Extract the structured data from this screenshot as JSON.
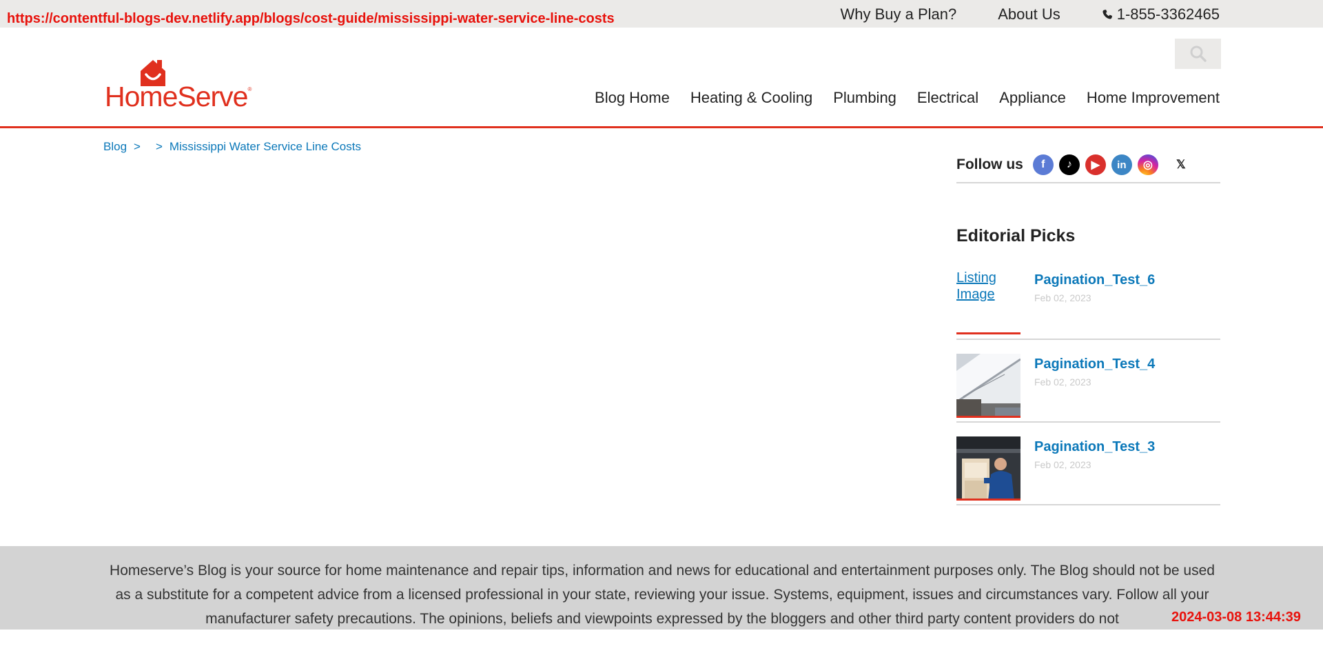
{
  "overlay": {
    "url": "https://contentful-blogs-dev.netlify.app/blogs/cost-guide/mississippi-water-service-line-costs",
    "timestamp": "2024-03-08 13:44:39"
  },
  "utility_nav": {
    "links": [
      "Why Buy a Plan?",
      "About Us"
    ],
    "phone": "1-855-3362465"
  },
  "brand": {
    "logo_text": "HomeServe",
    "logo_mark": "®",
    "color": "#e0301e"
  },
  "main_nav": {
    "items": [
      "Blog Home",
      "Heating & Cooling",
      "Plumbing",
      "Electrical",
      "Appliance",
      "Home Improvement"
    ]
  },
  "breadcrumb": {
    "items": [
      "Blog",
      "Mississippi Water Service Line Costs"
    ],
    "separator": ">"
  },
  "sidebar": {
    "follow_label": "Follow us",
    "social": [
      "facebook-icon",
      "tiktok-icon",
      "youtube-icon",
      "linkedin-icon",
      "instagram-icon",
      "x-icon"
    ],
    "editorial_title": "Editorial Picks",
    "picks": [
      {
        "title": "Pagination_Test_6",
        "date": "Feb 02, 2023",
        "image_alt": "Listing Image"
      },
      {
        "title": "Pagination_Test_4",
        "date": "Feb 02, 2023"
      },
      {
        "title": "Pagination_Test_3",
        "date": "Feb 02, 2023"
      }
    ]
  },
  "footer": {
    "disclaimer": "Homeserve’s Blog is your source for home maintenance and repair tips, information and news for educational and entertainment purposes only. The Blog should not be used as a substitute for a competent advice from a licensed professional in your state, reviewing your issue. Systems, equipment, issues and circumstances vary. Follow all your manufacturer safety precautions. The opinions, beliefs and viewpoints expressed by the bloggers and other third party content providers do not"
  }
}
